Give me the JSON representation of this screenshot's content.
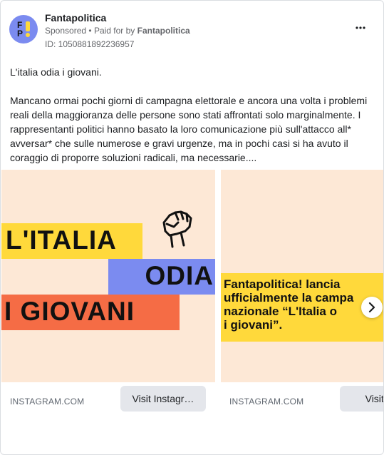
{
  "post": {
    "page_name": "Fantapolitica",
    "sponsored": "Sponsored",
    "separator": "•",
    "paid_for_by_label": "Paid for by",
    "paid_for_by_name": "Fantapolitica",
    "ad_id": "ID: 1050881892236957",
    "more_icon": "more-horizontal-icon",
    "avatar_letters": [
      "F",
      "P"
    ],
    "body_line1": "L'italia odia i giovani.",
    "body_paragraph": "Mancano ormai pochi giorni di campagna elettorale e ancora una volta i problemi reali della maggioranza delle persone sono stati affrontati solo marginalmente. I rappresentanti politici hanno basato la loro comunicazione più sull'attacco all* avversar* che sulle numerose e gravi urgenze, ma in pochi casi si ha avuto il coraggio di proporre soluzioni radicali, ma necessarie...."
  },
  "carousel": {
    "cards": [
      {
        "headline_lines": [
          "L'ITALIA",
          "ODIA",
          "I GIOVANI"
        ],
        "domain": "INSTAGRAM.COM",
        "cta": "Visit Instagr…"
      },
      {
        "headline": "Fantapolitica! lancia\nufficialmente la campa\nnazionale “L'Italia o\ni giovani”.",
        "domain": "INSTAGRAM.COM",
        "cta": "Visit Ins"
      }
    ],
    "next_icon": "chevron-right-icon"
  },
  "colors": {
    "creative_bg": "#fde8d6",
    "yellow": "#ffd93b",
    "blue": "#7b8bf0",
    "red": "#f56c45",
    "button_bg": "#e4e6eb",
    "secondary_text": "#65676b"
  }
}
